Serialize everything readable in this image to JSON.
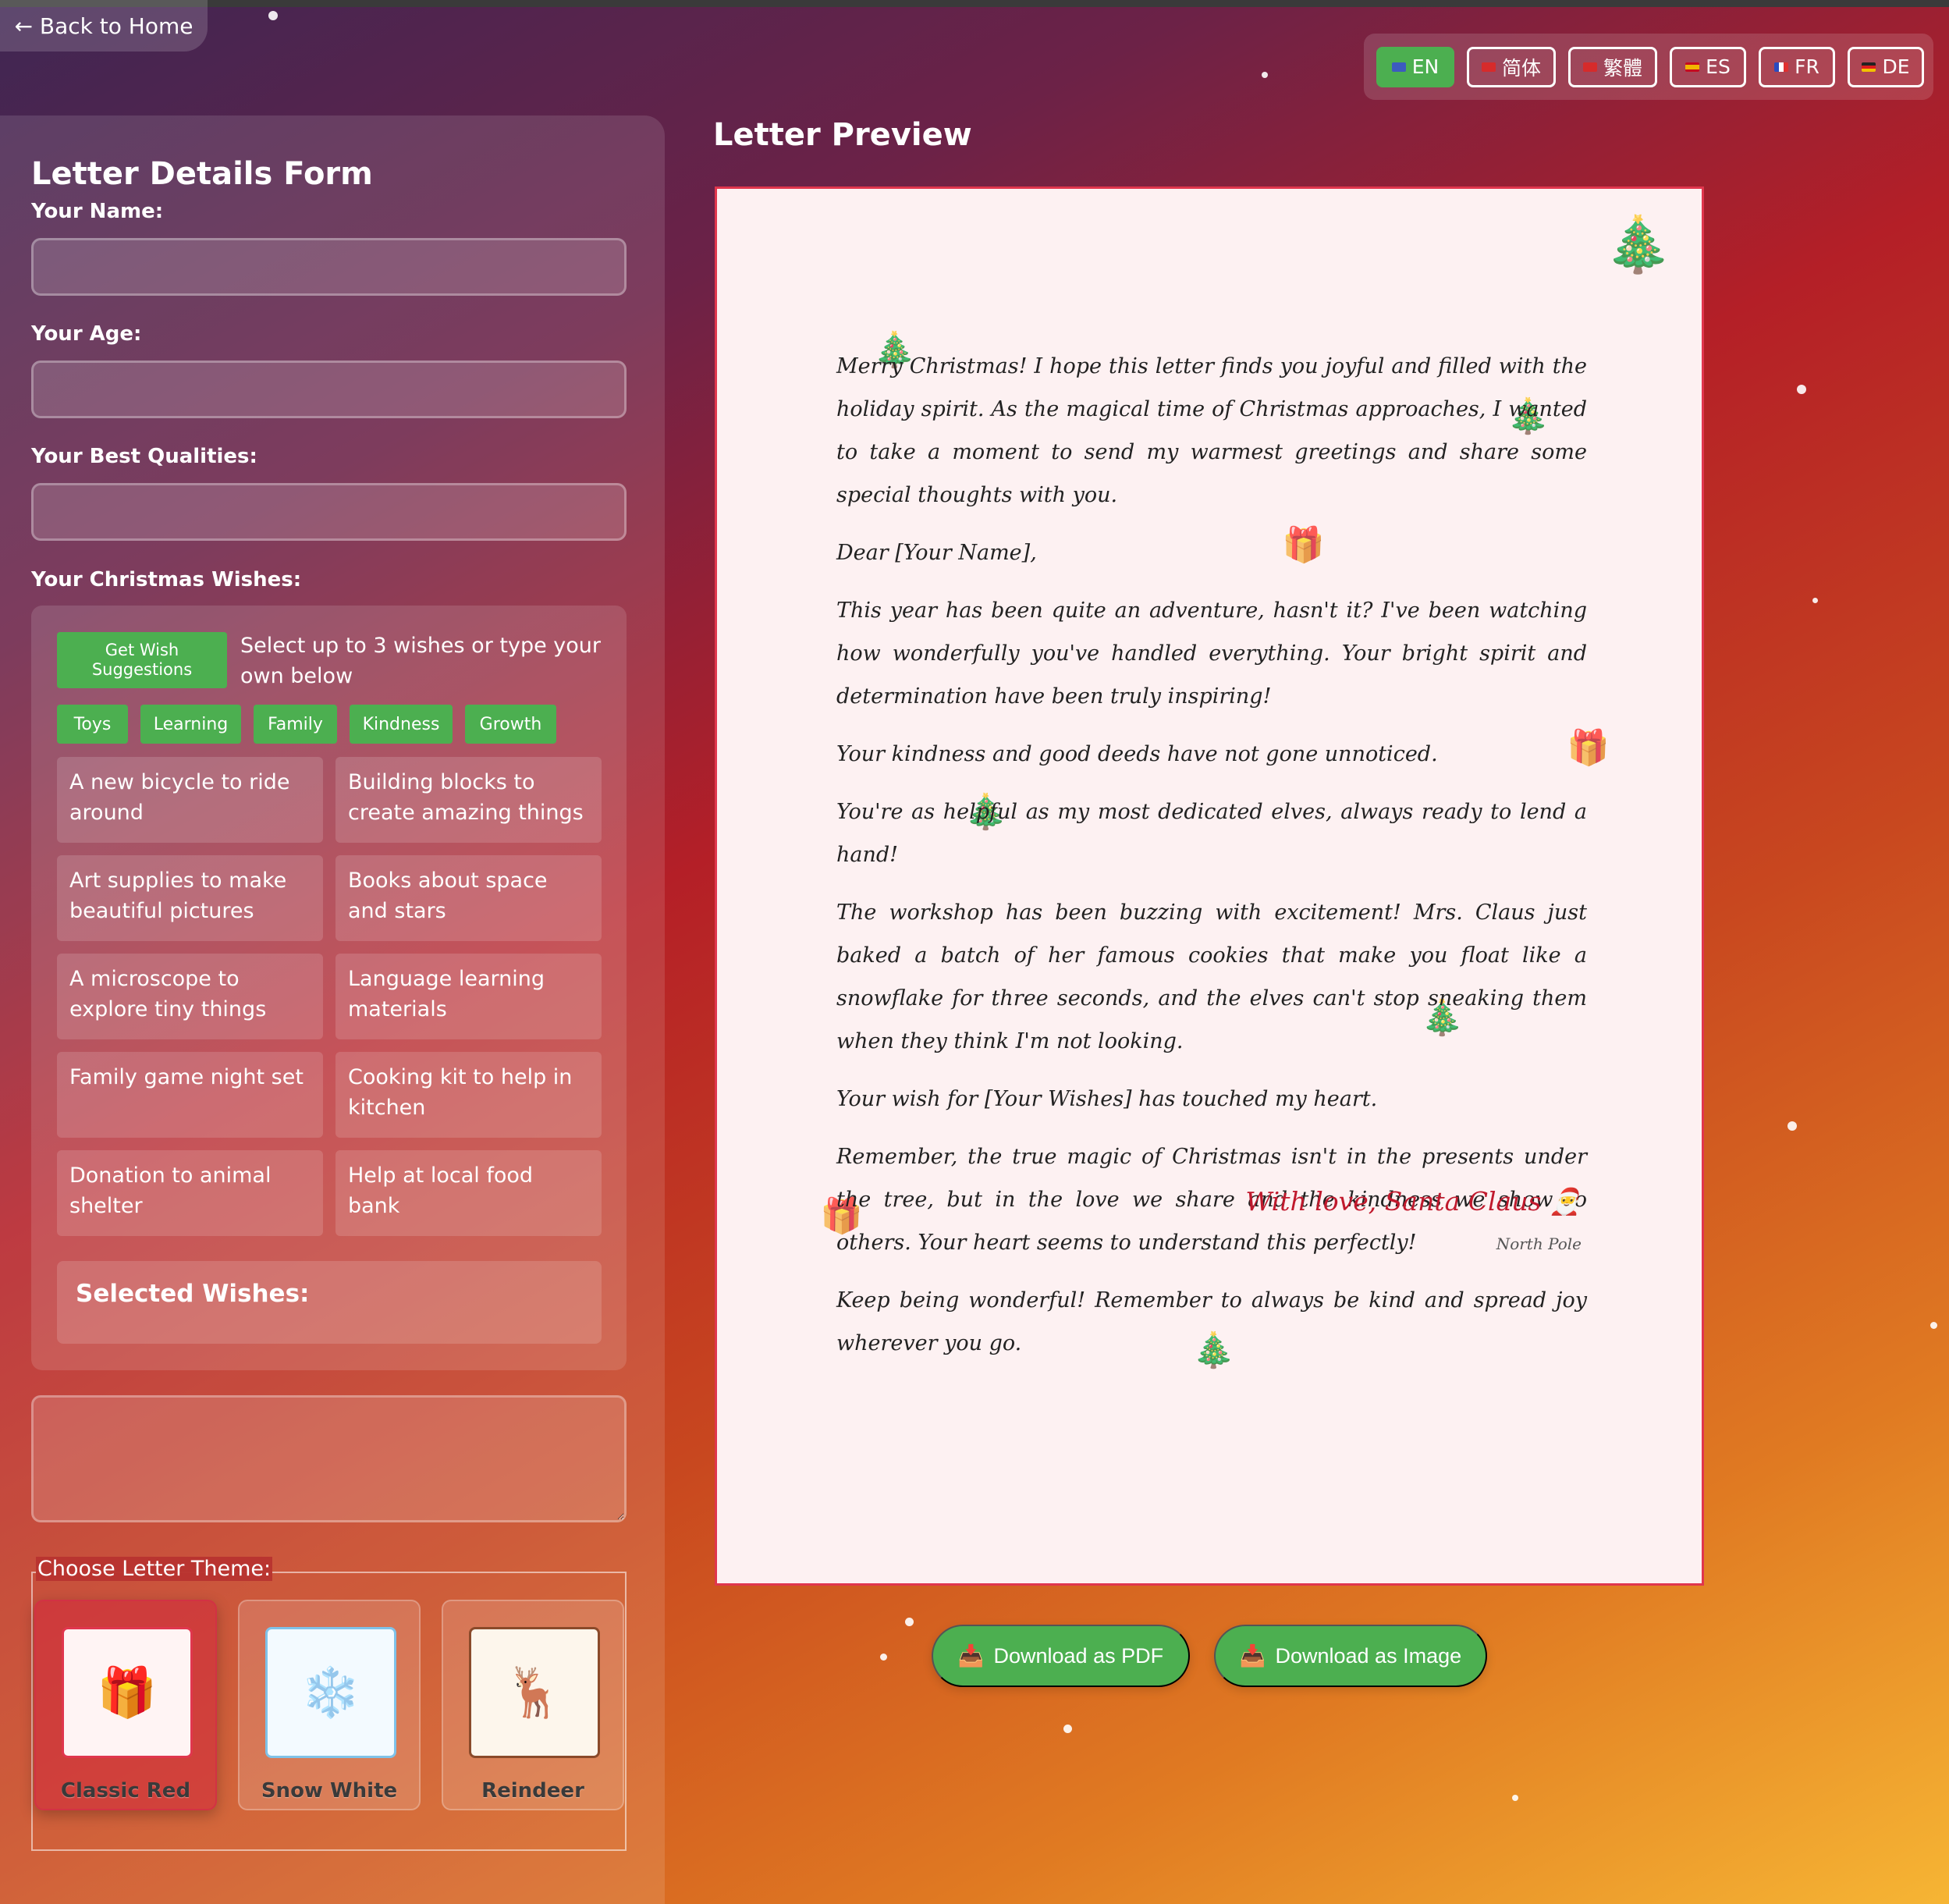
{
  "nav": {
    "back_label": "← Back to Home"
  },
  "languages": [
    {
      "code": "EN",
      "active": true,
      "flag_color": "#3c5bbf"
    },
    {
      "code": "简体",
      "active": false,
      "flag_color": "#d62b2b"
    },
    {
      "code": "繁體",
      "active": false,
      "flag_color": "#d62b2b"
    },
    {
      "code": "ES",
      "active": false,
      "flag_color": "#f2b600"
    },
    {
      "code": "FR",
      "active": false,
      "flag_color": "#2b4bbf"
    },
    {
      "code": "DE",
      "active": false,
      "flag_color": "#222222"
    }
  ],
  "form": {
    "title": "Letter Details Form",
    "name_label": "Your Name:",
    "age_label": "Your Age:",
    "qualities_label": "Your Best Qualities:",
    "wishes_label": "Your Christmas Wishes:",
    "suggest_button": "Get Wish Suggestions",
    "suggest_hint": "Select up to 3 wishes or type your own below",
    "categories": [
      "Toys",
      "Learning",
      "Family",
      "Kindness",
      "Growth"
    ],
    "wish_options": [
      "A new bicycle to ride around",
      "Building blocks to create amazing things",
      "Art supplies to make beautiful pictures",
      "Books about space and stars",
      "A microscope to explore tiny things",
      "Language learning materials",
      "Family game night set",
      "Cooking kit to help in kitchen",
      "Donation to animal shelter",
      "Help at local food bank"
    ],
    "selected_wishes_label": "Selected Wishes:",
    "theme_legend": "Choose Letter Theme:",
    "themes": [
      {
        "name": "Classic Red",
        "icon": "🎁",
        "selected": true
      },
      {
        "name": "Snow White",
        "icon": "❄️",
        "selected": false
      },
      {
        "name": "Reindeer",
        "icon": "🦌",
        "selected": false
      }
    ]
  },
  "preview": {
    "title": "Letter Preview",
    "paragraphs": [
      "Merry Christmas! I hope this letter finds you joyful and filled with the holiday spirit. As the magical time of Christmas approaches, I wanted to take a moment to send my warmest greetings and share some special thoughts with you.",
      "Dear [Your Name],",
      "This year has been quite an adventure, hasn't it? I've been watching how wonderfully you've handled everything. Your bright spirit and determination have been truly inspiring!",
      "Your kindness and good deeds have not gone unnoticed.",
      "You're as helpful as my most dedicated elves, always ready to lend a hand!",
      "The workshop has been buzzing with excitement! Mrs. Claus just baked a batch of her famous cookies that make you float like a snowflake for three seconds, and the elves can't stop sneaking them when they think I'm not looking.",
      "Your wish for [Your Wishes] has touched my heart.",
      "Remember, the true magic of Christmas isn't in the presents under the tree, but in the love we share and the kindness we show to others. Your heart seems to understand this perfectly!",
      "Keep being wonderful! Remember to always be kind and spread joy wherever you go."
    ],
    "signature": "With love, Santa Claus 🎅",
    "location": "North Pole"
  },
  "downloads": {
    "pdf_label": "Download as PDF",
    "image_label": "Download as Image",
    "icon": "📥"
  }
}
